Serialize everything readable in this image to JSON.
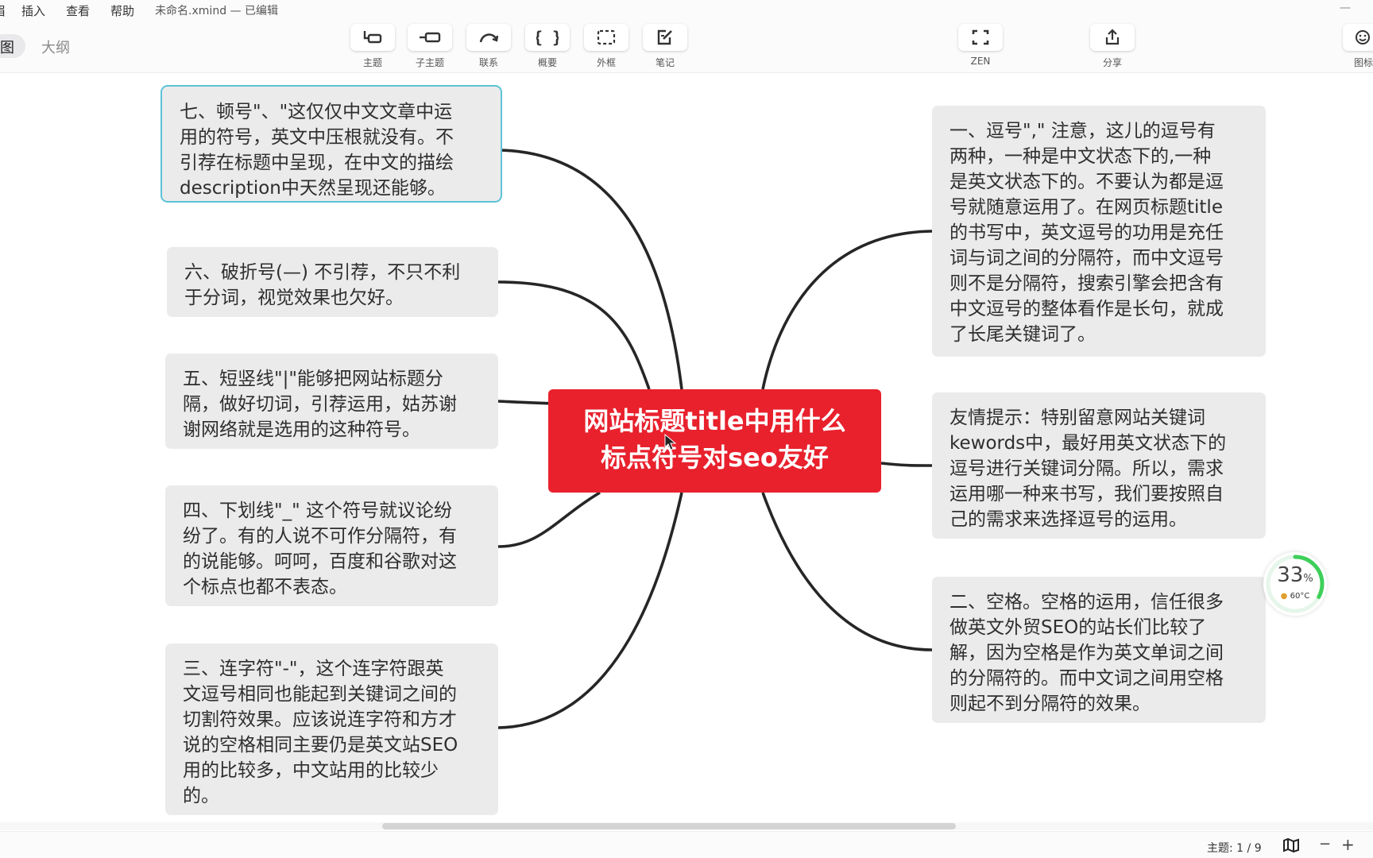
{
  "menubar": {
    "cut_item": "眉",
    "items": [
      "插入",
      "查看",
      "帮助"
    ],
    "file_title": "未命名.xmind — 已编辑",
    "minimize": "—"
  },
  "view_tabs": {
    "map": "图",
    "outline": "大纲"
  },
  "toolbar": {
    "tools": [
      {
        "label": "主题",
        "icon": "topic-icon"
      },
      {
        "label": "子主题",
        "icon": "subtopic-icon"
      },
      {
        "label": "联系",
        "icon": "relationship-icon"
      },
      {
        "label": "概要",
        "icon": "summary-icon"
      },
      {
        "label": "外框",
        "icon": "boundary-icon"
      },
      {
        "label": "笔记",
        "icon": "note-icon"
      },
      {
        "label": "ZEN",
        "icon": "zen-icon"
      },
      {
        "label": "分享",
        "icon": "share-icon"
      },
      {
        "label": "图标",
        "icon": "emoji-icon"
      }
    ]
  },
  "mindmap": {
    "central": {
      "line1": "网站标题title中用什么",
      "line2": "标点符号对seo友好"
    },
    "left_topics": [
      {
        "lines": [
          "七、顿号\"、\"这仅仅中文文章中运",
          "用的符号，英文中压根就没有。不",
          "引荐在标题中呈现，在中文的描绘",
          "description中天然呈现还能够。"
        ]
      },
      {
        "lines": [
          "六、破折号(—) 不引荐，不只不利",
          "于分词，视觉效果也欠好。"
        ]
      },
      {
        "lines": [
          "五、短竖线\"|\"能够把网站标题分",
          "隔，做好切词，引荐运用，姑苏谢",
          "谢网络就是选用的这种符号。"
        ]
      },
      {
        "lines": [
          "四、下划线\"_\" 这个符号就议论纷",
          "纷了。有的人说不可作分隔符，有",
          "的说能够。呵呵，百度和谷歌对这",
          "个标点也都不表态。"
        ]
      },
      {
        "lines": [
          "三、连字符\"-\"，这个连字符跟英",
          "文逗号相同也能起到关键词之间的",
          "切割符效果。应该说连字符和方才",
          "说的空格相同主要仍是英文站SEO",
          "用的比较多，中文站用的比较少",
          "的。"
        ]
      }
    ],
    "right_topics": [
      {
        "lines": [
          "一、逗号\",\" 注意，这儿的逗号有",
          "两种，一种是中文状态下的,一种",
          "是英文状态下的。不要认为都是逗",
          "号就随意运用了。在网页标题title",
          "的书写中，英文逗号的功用是充任",
          "词与词之间的分隔符，而中文逗号",
          "则不是分隔符，搜索引擎会把含有",
          "中文逗号的整体看作是长句，就成",
          "了长尾关键词了。"
        ]
      },
      {
        "lines": [
          "友情提示：特别留意网站关键词",
          "kewords中，最好用英文状态下的",
          "逗号进行关键词分隔。所以，需求",
          "运用哪一种来书写，我们要按照自",
          "己的需求来选择逗号的运用。"
        ]
      },
      {
        "lines": [
          "二、空格。空格的运用，信任很多",
          "做英文外贸SEO的站长们比较了",
          "解，因为空格是作为英文单词之间",
          "的分隔符的。而中文词之间用空格",
          "则起不到分隔符的效果。"
        ]
      }
    ]
  },
  "perf_widget": {
    "percent": "33",
    "percent_sign": "%",
    "temp": "60°C",
    "fraction": 0.33
  },
  "statusbar": {
    "topic_count": "主题: 1 / 9",
    "zoom_out": "−",
    "zoom_in": "+"
  },
  "colors": {
    "central_topic": "#e8212d",
    "topic_bg": "#ebebec",
    "selection": "#5bc3d6",
    "gauge": "#3ecf5a"
  }
}
